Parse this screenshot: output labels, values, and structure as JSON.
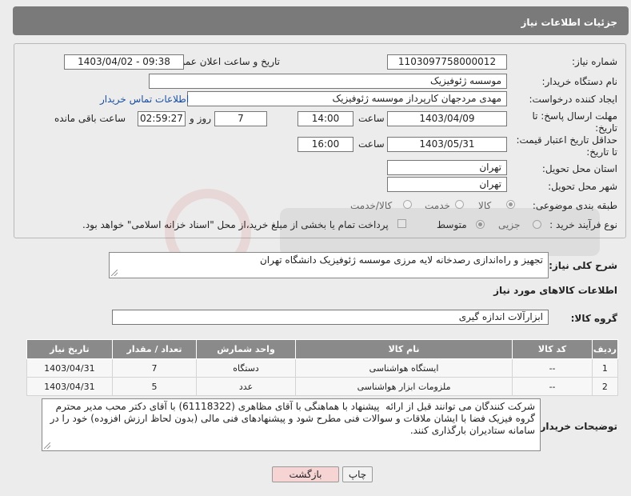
{
  "header": {
    "title": "جزئیات اطلاعات نیاز"
  },
  "form": {
    "need_number_label": "شماره نیاز:",
    "need_number": "1103097758000012",
    "announce_label": "تاریخ و ساعت اعلان عمومی:",
    "announce_value": "1403/04/02 - 09:38",
    "buyer_label": "نام دستگاه خریدار:",
    "buyer_value": "موسسه ژئوفیزیک",
    "creator_label": "ایجاد کننده درخواست:",
    "creator_value": "مهدی مردجهان کارپرداز موسسه ژئوفیزیک",
    "contact_link": "اطلاعات تماس خریدار",
    "deadline_label": "مهلت ارسال پاسخ: تا تاریخ:",
    "deadline_date": "1403/04/09",
    "time_label": "ساعت",
    "deadline_time": "14:00",
    "days_value": "7",
    "days_label": "روز و",
    "remaining_time": "02:59:27",
    "remaining_label": "ساعت باقی مانده",
    "validity_label": "حداقل تاریخ اعتبار قیمت: تا تاریخ:",
    "validity_date": "1403/05/31",
    "validity_time_label": "ساعت",
    "validity_time": "16:00",
    "province_label": "استان محل تحویل:",
    "province_value": "تهران",
    "city_label": "شهر محل تحویل:",
    "city_value": "تهران",
    "category_label": "طبقه بندی موضوعی:",
    "category_options": [
      "کالا",
      "خدمت",
      "کالا/خدمت"
    ],
    "category_selected": 0,
    "process_label": "نوع فرآیند خرید :",
    "process_options": [
      "جزیی",
      "متوسط"
    ],
    "process_selected": 1,
    "payment_note": "پرداخت تمام یا بخشی از مبلغ خرید،از محل \"اسناد خزانه اسلامی\" خواهد بود."
  },
  "description": {
    "label": "شرح کلی نیاز:",
    "value": "تجهیز و راه‌اندازی رصدخانه لایه مرزی موسسه ژئوفیزیک دانشگاه تهران"
  },
  "goods": {
    "section_title": "اطلاعات کالاهای مورد نیاز",
    "group_label": "گروه کالا:",
    "group_value": "ابزارآلات اندازه گیری",
    "columns": [
      "ردیف",
      "کد کالا",
      "نام کالا",
      "واحد شمارش",
      "تعداد / مقدار",
      "تاریخ نیاز"
    ],
    "rows": [
      {
        "row": "1",
        "code": "--",
        "name": "ایستگاه هواشناسی",
        "unit": "دستگاه",
        "qty": "7",
        "date": "1403/04/31"
      },
      {
        "row": "2",
        "code": "--",
        "name": "ملزومات ابزار هواشناسی",
        "unit": "عدد",
        "qty": "5",
        "date": "1403/04/31"
      }
    ]
  },
  "buyer_notes": {
    "label": "توضیحات خریدار:",
    "value": "شرکت کنندگان می توانند قبل از ارائه  پیشنهاد با هماهنگی با آقای مظاهری (61118322) با آقای دکتر محب مدیر محترم گروه فیزیک فضا با ایشان ملاقات و سوالات فنی مطرح شود و پیشنهادهای فنی مالی (بدون لحاظ ارزش افزوده) خود را در سامانه ستادیران بارگذاری کنند."
  },
  "buttons": {
    "print": "چاپ",
    "back": "بازگشت"
  },
  "colors": {
    "header_bg": "#7a7a7a",
    "table_header_bg": "#8a8a8a",
    "back_button_bg": "#f7d4d4",
    "link": "#1a4fa0"
  }
}
